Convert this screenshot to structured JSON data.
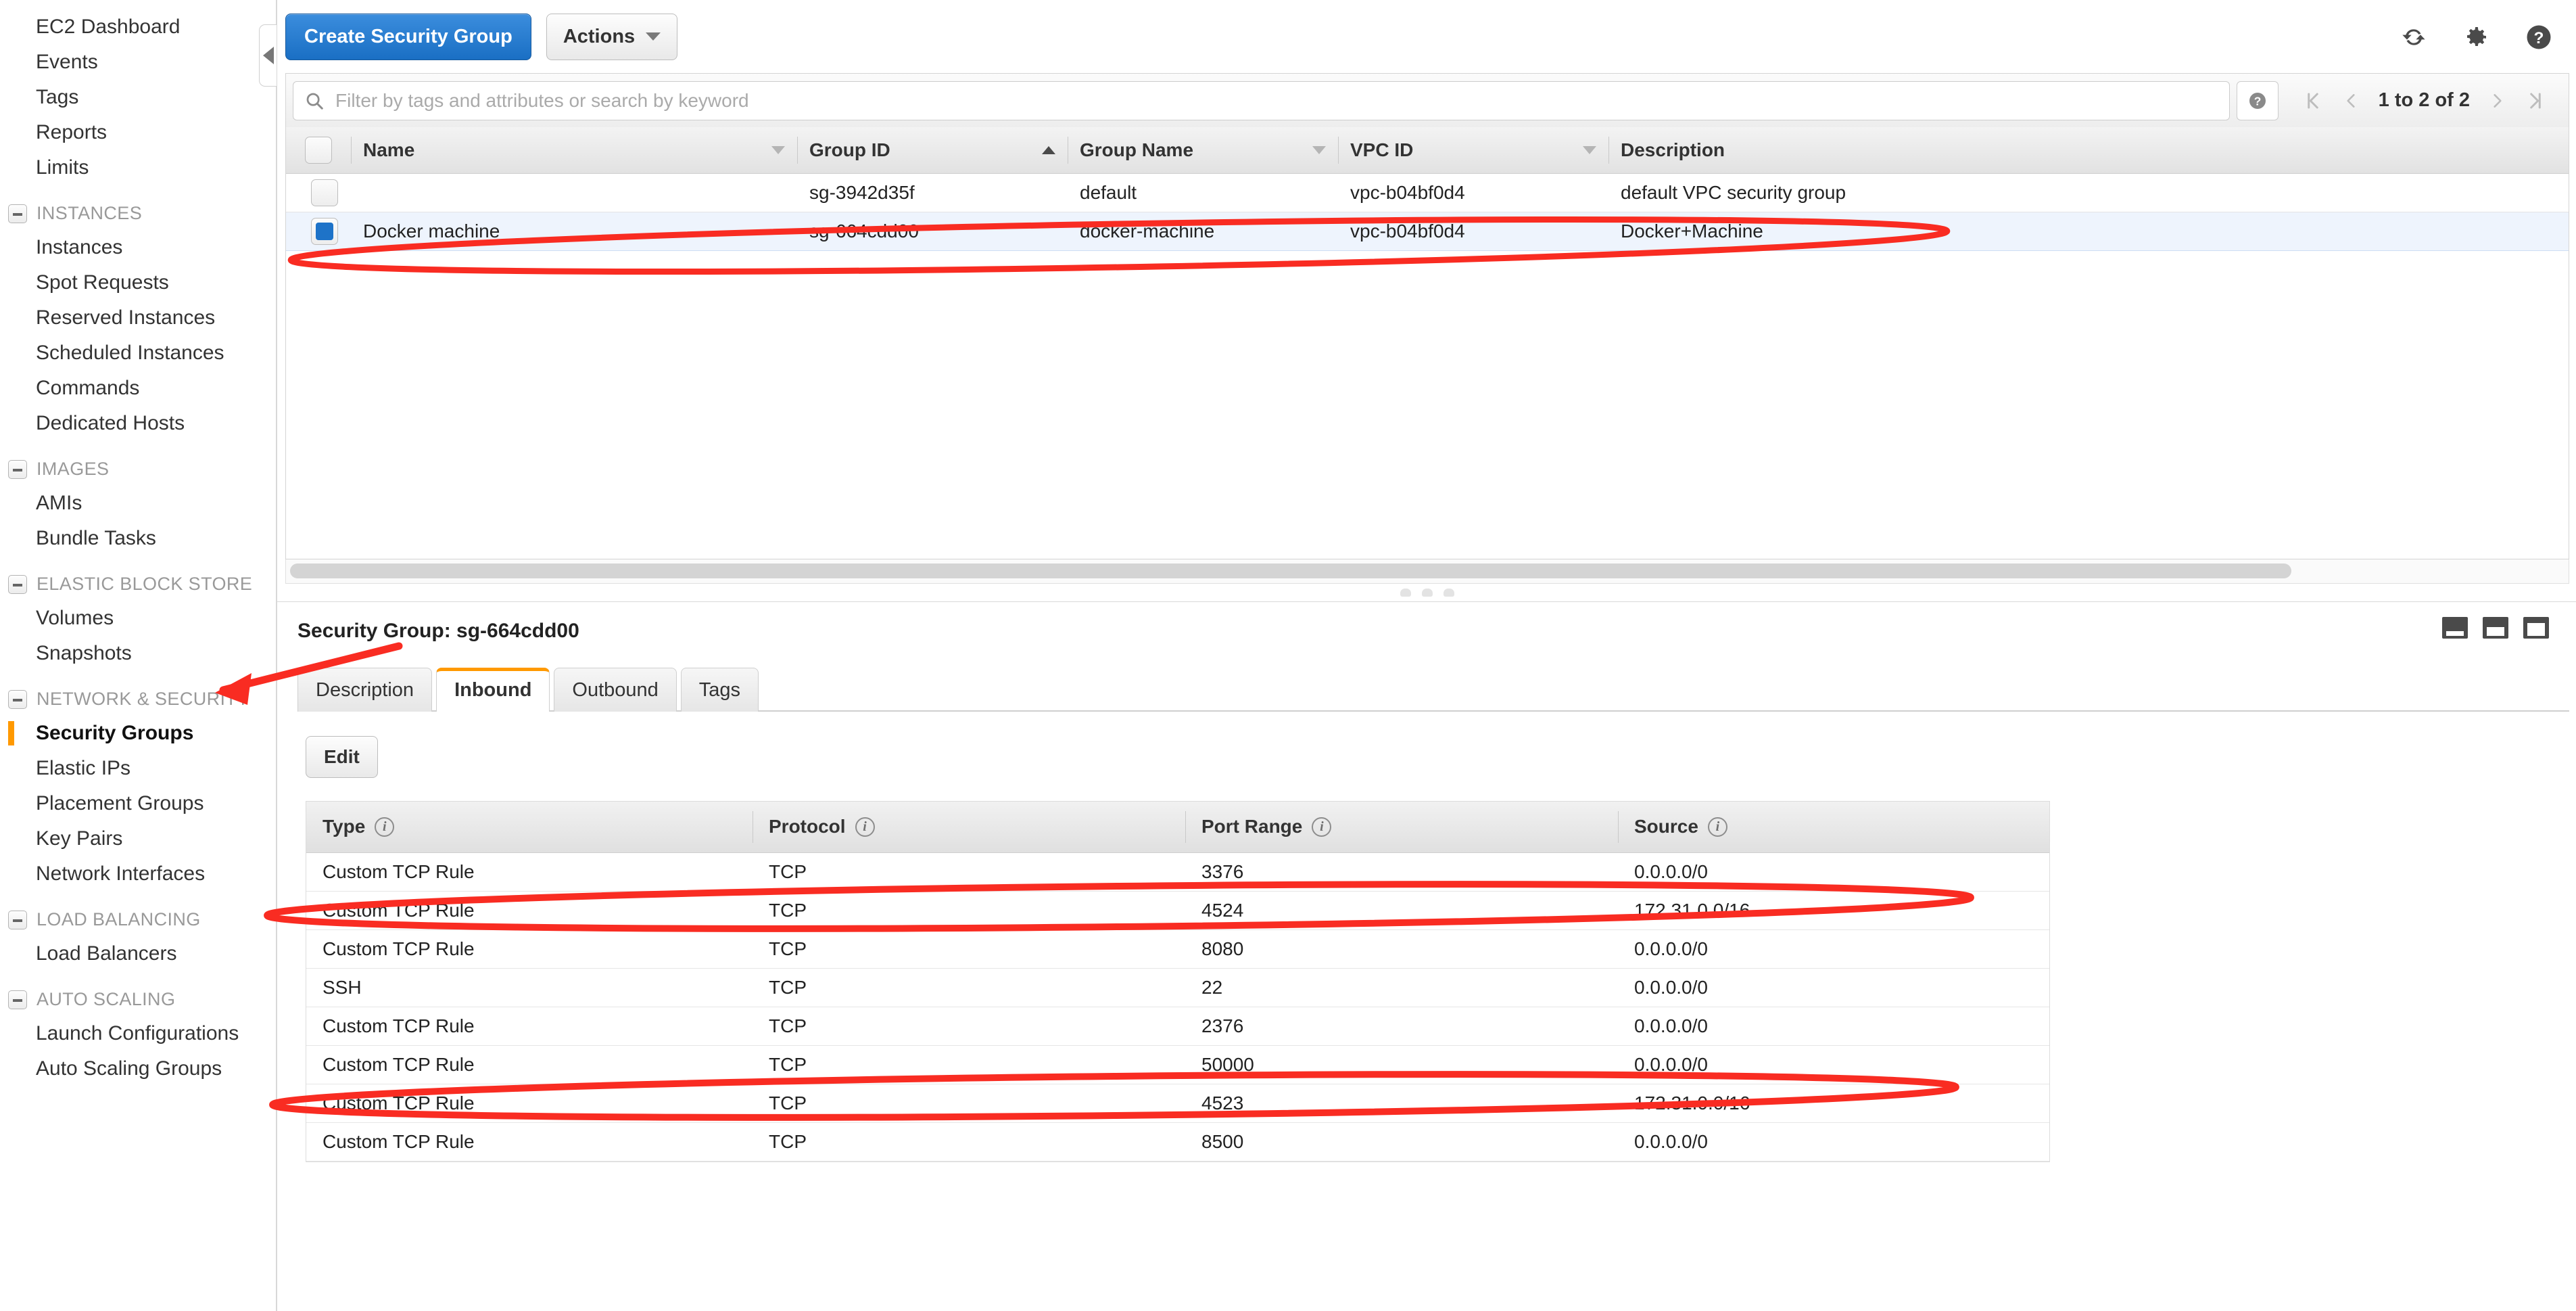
{
  "sidebar": {
    "top_items": [
      {
        "label": "EC2 Dashboard"
      },
      {
        "label": "Events"
      },
      {
        "label": "Tags"
      },
      {
        "label": "Reports"
      },
      {
        "label": "Limits"
      }
    ],
    "sections": [
      {
        "title": "INSTANCES",
        "items": [
          {
            "label": "Instances"
          },
          {
            "label": "Spot Requests"
          },
          {
            "label": "Reserved Instances"
          },
          {
            "label": "Scheduled Instances"
          },
          {
            "label": "Commands"
          },
          {
            "label": "Dedicated Hosts"
          }
        ]
      },
      {
        "title": "IMAGES",
        "items": [
          {
            "label": "AMIs"
          },
          {
            "label": "Bundle Tasks"
          }
        ]
      },
      {
        "title": "ELASTIC BLOCK STORE",
        "items": [
          {
            "label": "Volumes"
          },
          {
            "label": "Snapshots"
          }
        ]
      },
      {
        "title": "NETWORK & SECURITY",
        "items": [
          {
            "label": "Security Groups",
            "active": true
          },
          {
            "label": "Elastic IPs"
          },
          {
            "label": "Placement Groups"
          },
          {
            "label": "Key Pairs"
          },
          {
            "label": "Network Interfaces"
          }
        ]
      },
      {
        "title": "LOAD BALANCING",
        "items": [
          {
            "label": "Load Balancers"
          }
        ]
      },
      {
        "title": "AUTO SCALING",
        "items": [
          {
            "label": "Launch Configurations"
          },
          {
            "label": "Auto Scaling Groups"
          }
        ]
      }
    ]
  },
  "toolbar": {
    "create_label": "Create Security Group",
    "actions_label": "Actions",
    "icons": [
      "refresh-icon",
      "gear-icon",
      "help-icon"
    ]
  },
  "search": {
    "placeholder": "Filter by tags and attributes or search by keyword",
    "icon": "search-icon",
    "help_icon": "help-icon"
  },
  "pagination": {
    "range_label": "1 to 2 of 2",
    "first_icon": "page-first-icon",
    "prev_icon": "page-prev-icon",
    "next_icon": "page-next-icon",
    "last_icon": "page-last-icon"
  },
  "groups_table": {
    "columns": [
      {
        "label": "Name",
        "sort": "down"
      },
      {
        "label": "Group ID",
        "sort": "up"
      },
      {
        "label": "Group Name",
        "sort": "down"
      },
      {
        "label": "VPC ID",
        "sort": "down"
      },
      {
        "label": "Description",
        "sort": "none"
      }
    ],
    "rows": [
      {
        "selected": false,
        "name": "",
        "group_id": "sg-3942d35f",
        "group_name": "default",
        "vpc_id": "vpc-b04bf0d4",
        "description": "default VPC security group"
      },
      {
        "selected": true,
        "name": "Docker machine",
        "group_id": "sg-664cdd00",
        "group_name": "docker-machine",
        "vpc_id": "vpc-b04bf0d4",
        "description": "Docker+Machine"
      }
    ]
  },
  "detail": {
    "title": "Security Group: sg-664cdd00",
    "tabs": [
      {
        "label": "Description",
        "active": false
      },
      {
        "label": "Inbound",
        "active": true
      },
      {
        "label": "Outbound",
        "active": false
      },
      {
        "label": "Tags",
        "active": false
      }
    ],
    "edit_label": "Edit",
    "layout_icons": [
      "panel-small-icon",
      "panel-medium-icon",
      "panel-large-icon"
    ]
  },
  "rules_table": {
    "columns": [
      {
        "label": "Type",
        "info": "info-icon"
      },
      {
        "label": "Protocol",
        "info": "info-icon"
      },
      {
        "label": "Port Range",
        "info": "info-icon"
      },
      {
        "label": "Source",
        "info": "info-icon"
      }
    ],
    "rows": [
      {
        "type": "Custom TCP Rule",
        "protocol": "TCP",
        "port": "3376",
        "source": "0.0.0.0/0",
        "highlighted": false
      },
      {
        "type": "Custom TCP Rule",
        "protocol": "TCP",
        "port": "4524",
        "source": "172.31.0.0/16",
        "highlighted": true
      },
      {
        "type": "Custom TCP Rule",
        "protocol": "TCP",
        "port": "8080",
        "source": "0.0.0.0/0",
        "highlighted": false
      },
      {
        "type": "SSH",
        "protocol": "TCP",
        "port": "22",
        "source": "0.0.0.0/0",
        "highlighted": false
      },
      {
        "type": "Custom TCP Rule",
        "protocol": "TCP",
        "port": "2376",
        "source": "0.0.0.0/0",
        "highlighted": false
      },
      {
        "type": "Custom TCP Rule",
        "protocol": "TCP",
        "port": "50000",
        "source": "0.0.0.0/0",
        "highlighted": false
      },
      {
        "type": "Custom TCP Rule",
        "protocol": "TCP",
        "port": "4523",
        "source": "172.31.0.0/16",
        "highlighted": true
      },
      {
        "type": "Custom TCP Rule",
        "protocol": "TCP",
        "port": "8500",
        "source": "0.0.0.0/0",
        "highlighted": false
      }
    ]
  },
  "annotations": {
    "color": "#f92c22",
    "shapes": [
      {
        "kind": "ellipse",
        "target": "selected-group-row"
      },
      {
        "kind": "arrow",
        "target": "sidebar-item-security-groups"
      },
      {
        "kind": "ellipse",
        "target": "rule-row-4524"
      },
      {
        "kind": "ellipse",
        "target": "rule-row-4523"
      }
    ]
  }
}
